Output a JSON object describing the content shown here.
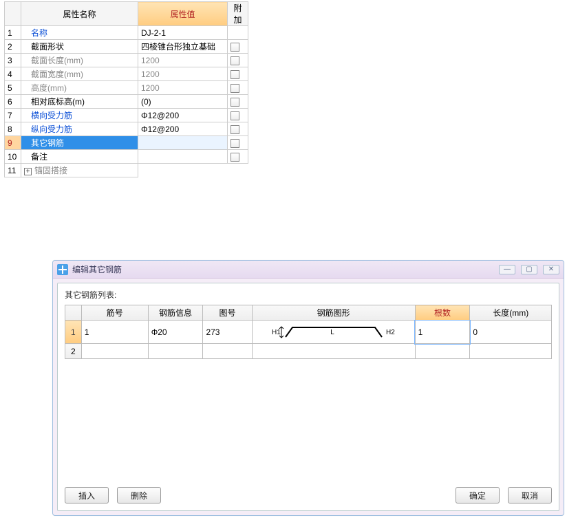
{
  "prop_header": {
    "name": "属性名称",
    "value": "属性值",
    "extra": "附加"
  },
  "props": [
    {
      "idx": "1",
      "name": "名称",
      "value": "DJ-2-1",
      "link": true,
      "gray": false,
      "cb": false
    },
    {
      "idx": "2",
      "name": "截面形状",
      "value": "四棱锥台形独立基础",
      "link": false,
      "gray": false,
      "cb": true
    },
    {
      "idx": "3",
      "name": "截面长度(mm)",
      "value": "1200",
      "link": false,
      "gray": true,
      "cb": true
    },
    {
      "idx": "4",
      "name": "截面宽度(mm)",
      "value": "1200",
      "link": false,
      "gray": true,
      "cb": true
    },
    {
      "idx": "5",
      "name": "高度(mm)",
      "value": "1200",
      "link": false,
      "gray": true,
      "cb": true
    },
    {
      "idx": "6",
      "name": "相对底标高(m)",
      "value": "(0)",
      "link": false,
      "gray": false,
      "cb": true
    },
    {
      "idx": "7",
      "name": "横向受力筋",
      "value": "Φ12@200",
      "link": true,
      "gray": false,
      "cb": true
    },
    {
      "idx": "8",
      "name": "纵向受力筋",
      "value": "Φ12@200",
      "link": true,
      "gray": false,
      "cb": true
    },
    {
      "idx": "9",
      "name": "其它钢筋",
      "value": "",
      "link": true,
      "gray": false,
      "cb": true,
      "selected": true
    },
    {
      "idx": "10",
      "name": "备注",
      "value": "",
      "link": false,
      "gray": false,
      "cb": true
    },
    {
      "idx": "11",
      "name": "锚固搭接",
      "value": "",
      "link": false,
      "gray": true,
      "cb": false,
      "expand": true
    }
  ],
  "dialog": {
    "title": "编辑其它钢筋",
    "list_label": "其它钢筋列表:",
    "headers": {
      "num": "筋号",
      "info": "钢筋信息",
      "fig": "图号",
      "shape": "钢筋图形",
      "count": "根数",
      "len": "长度(mm)"
    },
    "rows": [
      {
        "idx": "1",
        "num": "1",
        "info": "Φ20",
        "fig": "273",
        "shape_h1": "H1",
        "shape_l": "L",
        "shape_h2": "H2",
        "count": "1",
        "len": "0",
        "active": true
      },
      {
        "idx": "2",
        "num": "",
        "info": "",
        "fig": "",
        "count": "",
        "len": "",
        "active": false,
        "empty": true
      }
    ],
    "buttons": {
      "insert": "插入",
      "delete": "删除",
      "ok": "确定",
      "cancel": "取消"
    }
  }
}
